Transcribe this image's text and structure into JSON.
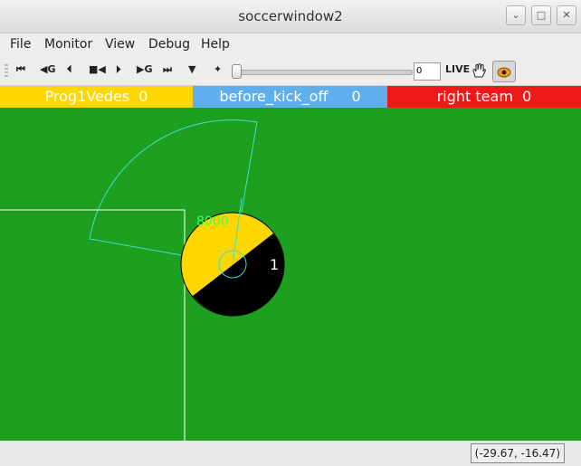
{
  "window": {
    "title": "soccerwindow2",
    "minimize_glyph": "⌄",
    "maximize_glyph": "□",
    "close_glyph": "✕"
  },
  "menu": {
    "items": [
      "File",
      "Monitor",
      "View",
      "Debug",
      "Help"
    ]
  },
  "toolbar": {
    "buttons": [
      {
        "name": "go-first",
        "glyph": "⏮"
      },
      {
        "name": "go-prev-goal",
        "glyph": "◀G"
      },
      {
        "name": "step-back",
        "glyph": "⏴"
      },
      {
        "name": "play-back",
        "glyph": "■◀"
      },
      {
        "name": "step-forward",
        "glyph": "⏵"
      },
      {
        "name": "go-next-goal",
        "glyph": "▶G"
      },
      {
        "name": "go-last",
        "glyph": "⏭"
      },
      {
        "name": "drop-ball",
        "glyph": "▼"
      },
      {
        "name": "kick-off",
        "glyph": "✦"
      }
    ],
    "cycle_value": "0",
    "live_label": "LIVE",
    "slider_position": 0
  },
  "score": {
    "left_team": "Prog1Vedes",
    "left_score": "0",
    "play_mode": "before_kick_off",
    "play_mode_count": "0",
    "right_team": "right team",
    "right_score": "0",
    "left_color": "#ffd700",
    "center_color": "#5fafef",
    "right_color": "#f01919"
  },
  "field": {
    "color": "#1f9f1f",
    "player": {
      "number": "1",
      "stamina": "8000",
      "team_color": "#ffd700",
      "body_color": "#000000"
    }
  },
  "status": {
    "coords": "(-29.67, -16.47)"
  },
  "icons": {
    "hand": "hand-drag-icon",
    "mode": "monitor-mode-icon"
  }
}
